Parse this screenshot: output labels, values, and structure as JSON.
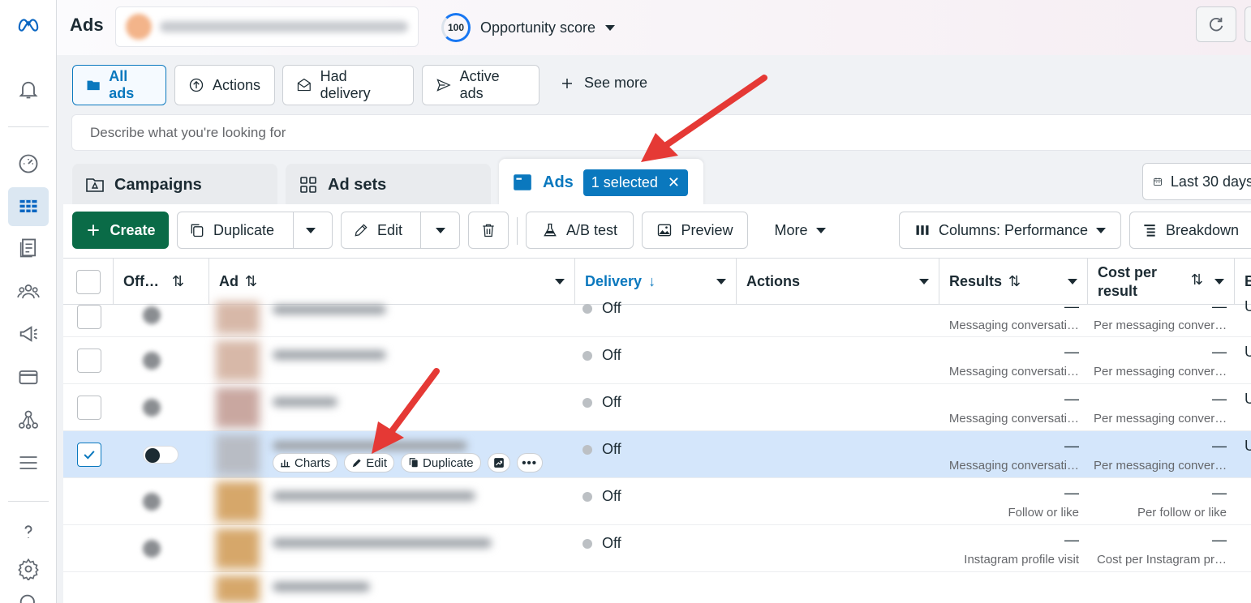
{
  "app": {
    "title": "Ads"
  },
  "opportunity": {
    "score": "100",
    "label": "Opportunity score"
  },
  "filters": [
    {
      "label": "All ads",
      "active": true
    },
    {
      "label": "Actions"
    },
    {
      "label": "Had delivery"
    },
    {
      "label": "Active ads"
    }
  ],
  "see_more": "See more",
  "search": {
    "placeholder": "Describe what you're looking for"
  },
  "level_tabs": {
    "campaigns": "Campaigns",
    "adsets": "Ad sets",
    "ads": "Ads",
    "selected_badge": "1 selected"
  },
  "date_range": "Last 30 days",
  "toolbar": {
    "create": "Create",
    "duplicate": "Duplicate",
    "edit": "Edit",
    "ab_test": "A/B test",
    "preview": "Preview",
    "more": "More",
    "columns": "Columns: Performance",
    "breakdown": "Breakdown"
  },
  "table": {
    "headers": {
      "offon": "Off…",
      "ad": "Ad",
      "delivery": "Delivery",
      "actions": "Actions",
      "results": "Results",
      "cost_per_result_1": "Cost per",
      "cost_per_result_2": "result",
      "edge": "B"
    },
    "rows": [
      {
        "delivery": "Off",
        "result": "—",
        "result_sub": "Messaging conversati…",
        "cost": "—",
        "cost_sub": "Per messaging conver…",
        "edge": "U"
      },
      {
        "delivery": "Off",
        "result": "—",
        "result_sub": "Messaging conversati…",
        "cost": "—",
        "cost_sub": "Per messaging conver…",
        "edge": "U"
      },
      {
        "delivery": "Off",
        "result": "—",
        "result_sub": "Messaging conversati…",
        "cost": "—",
        "cost_sub": "Per messaging conver…",
        "edge": "U"
      },
      {
        "delivery": "Off",
        "result": "—",
        "result_sub": "Messaging conversati…",
        "cost": "—",
        "cost_sub": "Per messaging conver…",
        "edge": "U"
      },
      {
        "delivery": "Off",
        "result": "—",
        "result_sub": "Follow or like",
        "cost": "—",
        "cost_sub": "Per follow or like",
        "edge": ""
      },
      {
        "delivery": "Off",
        "result": "—",
        "result_sub": "Instagram profile visit",
        "cost": "—",
        "cost_sub": "Cost per Instagram pr…",
        "edge": ""
      }
    ],
    "hover_actions": {
      "charts": "Charts",
      "edit": "Edit",
      "duplicate": "Duplicate"
    }
  },
  "colors": {
    "accent": "#0a78be",
    "create": "#0a6b47",
    "selected_row": "#d4e6fb",
    "arrow": "#e53935"
  }
}
